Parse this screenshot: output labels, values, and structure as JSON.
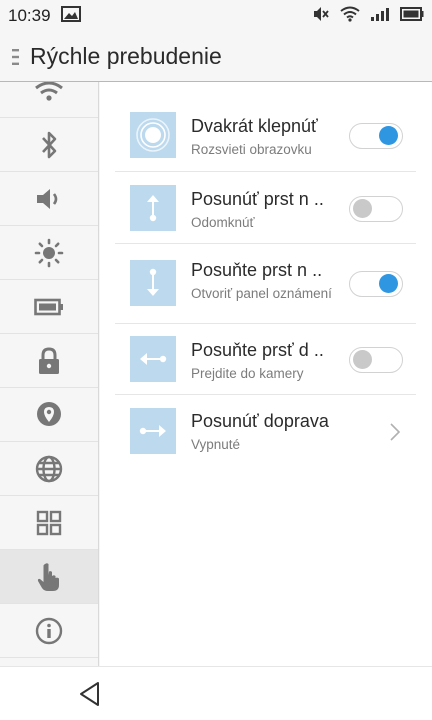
{
  "status": {
    "time": "10:39"
  },
  "header": {
    "title": "Rýchle prebudenie"
  },
  "sidebar": {
    "items": [
      {
        "icon": "wifi-icon"
      },
      {
        "icon": "bluetooth-icon"
      },
      {
        "icon": "volume-icon"
      },
      {
        "icon": "brightness-icon"
      },
      {
        "icon": "battery-icon"
      },
      {
        "icon": "lock-icon"
      },
      {
        "icon": "location-icon"
      },
      {
        "icon": "globe-icon"
      },
      {
        "icon": "apps-grid-icon"
      },
      {
        "icon": "hand-gesture-icon",
        "active": true
      },
      {
        "icon": "info-icon"
      }
    ]
  },
  "gestures": [
    {
      "title": "Dvakrát klepnúť",
      "subtitle": "Rozsvieti obrazovku",
      "toggle": "on",
      "icon": "double-tap-icon"
    },
    {
      "title": "Posunúť prst n ..",
      "subtitle": "Odomknúť",
      "toggle": "off",
      "icon": "swipe-up-icon"
    },
    {
      "title": "Posuňte prst n ..",
      "subtitle": "Otvoriť panel oznámení",
      "toggle": "on",
      "icon": "swipe-down-icon"
    },
    {
      "title": "Posuňte prsť d ..",
      "subtitle": "Prejdite do kamery",
      "toggle": "off",
      "icon": "swipe-left-icon"
    },
    {
      "title": "Posunúť doprava",
      "subtitle": "Vypnuté",
      "toggle": null,
      "icon": "swipe-right-icon"
    }
  ],
  "colors": {
    "accent": "#2f96e2",
    "tile": "#bcd9ee",
    "header_line": "#8fc3ef"
  }
}
